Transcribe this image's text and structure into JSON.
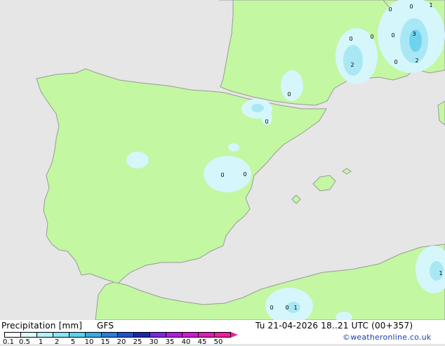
{
  "map": {
    "colors": {
      "sea": "#e6e6e6",
      "land": "#c3f7a1",
      "coast": "#9a9a9a",
      "rain_light": "#d5f6fb",
      "rain_mid": "#a9e7f5",
      "rain_high": "#6fd3ef"
    },
    "contour_labels": [
      "0",
      "0",
      "0",
      "0",
      "0",
      "0",
      "1",
      "3",
      "2",
      "2",
      "0",
      "0",
      "0",
      "0",
      "0",
      "0",
      "1",
      "1"
    ]
  },
  "footer": {
    "title": "Precipitation [mm]",
    "model": "GFS",
    "datetime": "Tu 21-04-2026 18..21 UTC (00+357)",
    "copyright": "©weatheronline.co.uk",
    "legend": {
      "ticks": [
        "0.1",
        "0.5",
        "1",
        "2",
        "5",
        "10",
        "15",
        "20",
        "25",
        "30",
        "35",
        "40",
        "45",
        "50"
      ],
      "colors": [
        "#ffffff",
        "#e0fbfd",
        "#b4f1fb",
        "#88e6f6",
        "#5bd2ee",
        "#3aa9e2",
        "#2c7fd6",
        "#2250c8",
        "#1a2aa6",
        "#7a2ae0",
        "#b21fdc",
        "#d21ad0",
        "#e21bb8",
        "#f21da0"
      ]
    }
  }
}
